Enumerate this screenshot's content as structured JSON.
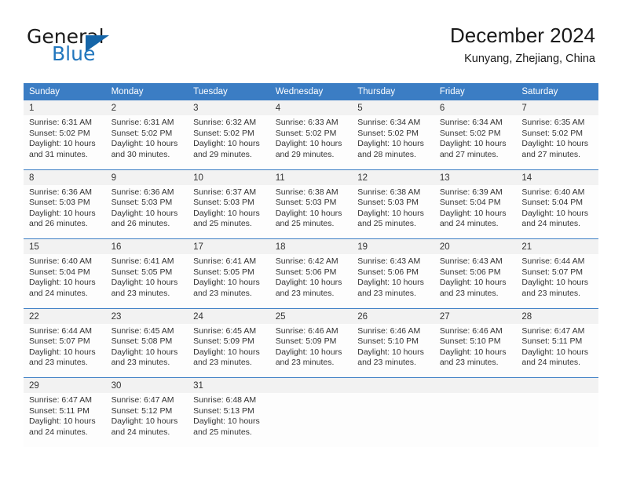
{
  "brand": {
    "name_part1": "General",
    "name_part2": "Blue",
    "accent_color": "#1565a8",
    "blue_text_color": "#2176bd"
  },
  "header": {
    "title": "December 2024",
    "subtitle": "Kunyang, Zhejiang, China"
  },
  "calendar": {
    "header_bg": "#3b7dc4",
    "daynum_bg": "#f2f2f2",
    "weekday_headers": [
      "Sunday",
      "Monday",
      "Tuesday",
      "Wednesday",
      "Thursday",
      "Friday",
      "Saturday"
    ],
    "weeks": [
      {
        "daynums": [
          "1",
          "2",
          "3",
          "4",
          "5",
          "6",
          "7"
        ],
        "cells": [
          {
            "sunrise": "Sunrise: 6:31 AM",
            "sunset": "Sunset: 5:02 PM",
            "daylight_1": "Daylight: 10 hours",
            "daylight_2": "and 31 minutes."
          },
          {
            "sunrise": "Sunrise: 6:31 AM",
            "sunset": "Sunset: 5:02 PM",
            "daylight_1": "Daylight: 10 hours",
            "daylight_2": "and 30 minutes."
          },
          {
            "sunrise": "Sunrise: 6:32 AM",
            "sunset": "Sunset: 5:02 PM",
            "daylight_1": "Daylight: 10 hours",
            "daylight_2": "and 29 minutes."
          },
          {
            "sunrise": "Sunrise: 6:33 AM",
            "sunset": "Sunset: 5:02 PM",
            "daylight_1": "Daylight: 10 hours",
            "daylight_2": "and 29 minutes."
          },
          {
            "sunrise": "Sunrise: 6:34 AM",
            "sunset": "Sunset: 5:02 PM",
            "daylight_1": "Daylight: 10 hours",
            "daylight_2": "and 28 minutes."
          },
          {
            "sunrise": "Sunrise: 6:34 AM",
            "sunset": "Sunset: 5:02 PM",
            "daylight_1": "Daylight: 10 hours",
            "daylight_2": "and 27 minutes."
          },
          {
            "sunrise": "Sunrise: 6:35 AM",
            "sunset": "Sunset: 5:02 PM",
            "daylight_1": "Daylight: 10 hours",
            "daylight_2": "and 27 minutes."
          }
        ]
      },
      {
        "daynums": [
          "8",
          "9",
          "10",
          "11",
          "12",
          "13",
          "14"
        ],
        "cells": [
          {
            "sunrise": "Sunrise: 6:36 AM",
            "sunset": "Sunset: 5:03 PM",
            "daylight_1": "Daylight: 10 hours",
            "daylight_2": "and 26 minutes."
          },
          {
            "sunrise": "Sunrise: 6:36 AM",
            "sunset": "Sunset: 5:03 PM",
            "daylight_1": "Daylight: 10 hours",
            "daylight_2": "and 26 minutes."
          },
          {
            "sunrise": "Sunrise: 6:37 AM",
            "sunset": "Sunset: 5:03 PM",
            "daylight_1": "Daylight: 10 hours",
            "daylight_2": "and 25 minutes."
          },
          {
            "sunrise": "Sunrise: 6:38 AM",
            "sunset": "Sunset: 5:03 PM",
            "daylight_1": "Daylight: 10 hours",
            "daylight_2": "and 25 minutes."
          },
          {
            "sunrise": "Sunrise: 6:38 AM",
            "sunset": "Sunset: 5:03 PM",
            "daylight_1": "Daylight: 10 hours",
            "daylight_2": "and 25 minutes."
          },
          {
            "sunrise": "Sunrise: 6:39 AM",
            "sunset": "Sunset: 5:04 PM",
            "daylight_1": "Daylight: 10 hours",
            "daylight_2": "and 24 minutes."
          },
          {
            "sunrise": "Sunrise: 6:40 AM",
            "sunset": "Sunset: 5:04 PM",
            "daylight_1": "Daylight: 10 hours",
            "daylight_2": "and 24 minutes."
          }
        ]
      },
      {
        "daynums": [
          "15",
          "16",
          "17",
          "18",
          "19",
          "20",
          "21"
        ],
        "cells": [
          {
            "sunrise": "Sunrise: 6:40 AM",
            "sunset": "Sunset: 5:04 PM",
            "daylight_1": "Daylight: 10 hours",
            "daylight_2": "and 24 minutes."
          },
          {
            "sunrise": "Sunrise: 6:41 AM",
            "sunset": "Sunset: 5:05 PM",
            "daylight_1": "Daylight: 10 hours",
            "daylight_2": "and 23 minutes."
          },
          {
            "sunrise": "Sunrise: 6:41 AM",
            "sunset": "Sunset: 5:05 PM",
            "daylight_1": "Daylight: 10 hours",
            "daylight_2": "and 23 minutes."
          },
          {
            "sunrise": "Sunrise: 6:42 AM",
            "sunset": "Sunset: 5:06 PM",
            "daylight_1": "Daylight: 10 hours",
            "daylight_2": "and 23 minutes."
          },
          {
            "sunrise": "Sunrise: 6:43 AM",
            "sunset": "Sunset: 5:06 PM",
            "daylight_1": "Daylight: 10 hours",
            "daylight_2": "and 23 minutes."
          },
          {
            "sunrise": "Sunrise: 6:43 AM",
            "sunset": "Sunset: 5:06 PM",
            "daylight_1": "Daylight: 10 hours",
            "daylight_2": "and 23 minutes."
          },
          {
            "sunrise": "Sunrise: 6:44 AM",
            "sunset": "Sunset: 5:07 PM",
            "daylight_1": "Daylight: 10 hours",
            "daylight_2": "and 23 minutes."
          }
        ]
      },
      {
        "daynums": [
          "22",
          "23",
          "24",
          "25",
          "26",
          "27",
          "28"
        ],
        "cells": [
          {
            "sunrise": "Sunrise: 6:44 AM",
            "sunset": "Sunset: 5:07 PM",
            "daylight_1": "Daylight: 10 hours",
            "daylight_2": "and 23 minutes."
          },
          {
            "sunrise": "Sunrise: 6:45 AM",
            "sunset": "Sunset: 5:08 PM",
            "daylight_1": "Daylight: 10 hours",
            "daylight_2": "and 23 minutes."
          },
          {
            "sunrise": "Sunrise: 6:45 AM",
            "sunset": "Sunset: 5:09 PM",
            "daylight_1": "Daylight: 10 hours",
            "daylight_2": "and 23 minutes."
          },
          {
            "sunrise": "Sunrise: 6:46 AM",
            "sunset": "Sunset: 5:09 PM",
            "daylight_1": "Daylight: 10 hours",
            "daylight_2": "and 23 minutes."
          },
          {
            "sunrise": "Sunrise: 6:46 AM",
            "sunset": "Sunset: 5:10 PM",
            "daylight_1": "Daylight: 10 hours",
            "daylight_2": "and 23 minutes."
          },
          {
            "sunrise": "Sunrise: 6:46 AM",
            "sunset": "Sunset: 5:10 PM",
            "daylight_1": "Daylight: 10 hours",
            "daylight_2": "and 23 minutes."
          },
          {
            "sunrise": "Sunrise: 6:47 AM",
            "sunset": "Sunset: 5:11 PM",
            "daylight_1": "Daylight: 10 hours",
            "daylight_2": "and 24 minutes."
          }
        ]
      },
      {
        "daynums": [
          "29",
          "30",
          "31",
          "",
          "",
          "",
          ""
        ],
        "cells": [
          {
            "sunrise": "Sunrise: 6:47 AM",
            "sunset": "Sunset: 5:11 PM",
            "daylight_1": "Daylight: 10 hours",
            "daylight_2": "and 24 minutes."
          },
          {
            "sunrise": "Sunrise: 6:47 AM",
            "sunset": "Sunset: 5:12 PM",
            "daylight_1": "Daylight: 10 hours",
            "daylight_2": "and 24 minutes."
          },
          {
            "sunrise": "Sunrise: 6:48 AM",
            "sunset": "Sunset: 5:13 PM",
            "daylight_1": "Daylight: 10 hours",
            "daylight_2": "and 25 minutes."
          },
          {
            "sunrise": "",
            "sunset": "",
            "daylight_1": "",
            "daylight_2": ""
          },
          {
            "sunrise": "",
            "sunset": "",
            "daylight_1": "",
            "daylight_2": ""
          },
          {
            "sunrise": "",
            "sunset": "",
            "daylight_1": "",
            "daylight_2": ""
          },
          {
            "sunrise": "",
            "sunset": "",
            "daylight_1": "",
            "daylight_2": ""
          }
        ]
      }
    ]
  }
}
